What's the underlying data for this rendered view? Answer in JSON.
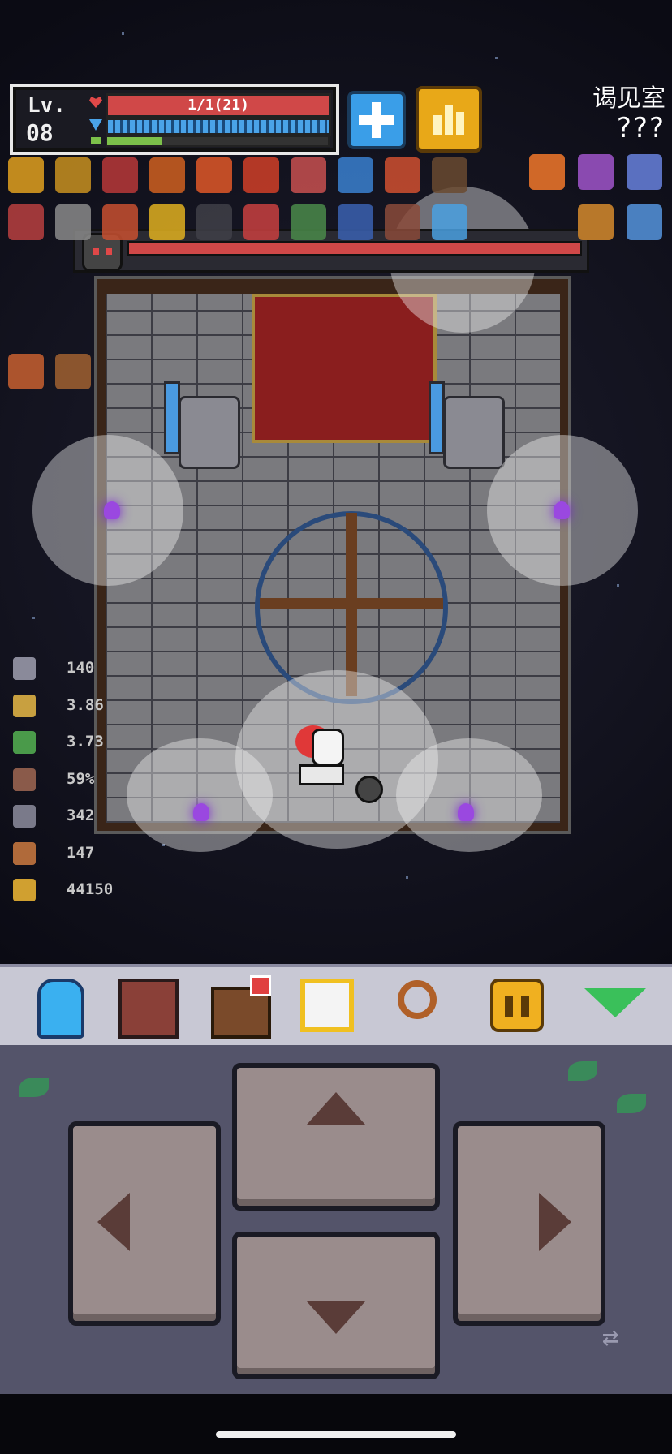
{
  "hud": {
    "level_label": "Lv.",
    "level_value": "08",
    "hp_text": "1/1(21)",
    "xp_fraction": 0.25,
    "mp_fraction": 1.0
  },
  "room": {
    "title": "谒见室",
    "subtitle": "???"
  },
  "boss": {
    "hp_fraction": 1.0
  },
  "stats": [
    {
      "icon": "sword-attack-icon",
      "value": "140",
      "color": "#8a8a9a"
    },
    {
      "icon": "crit-icon",
      "value": "3.86",
      "color": "#c8a040"
    },
    {
      "icon": "speed-boot-icon",
      "value": "3.73",
      "color": "#4a9a4a"
    },
    {
      "icon": "shield-icon",
      "value": "59%",
      "color": "#8a5a4a"
    },
    {
      "icon": "gray-key-icon",
      "value": "342",
      "color": "#7a7a8a"
    },
    {
      "icon": "bronze-key-icon",
      "value": "147",
      "color": "#b06a3a"
    },
    {
      "icon": "gold-coin-icon",
      "value": "44150",
      "color": "#d0a030"
    }
  ],
  "items": [
    {
      "icon": "golden-helm-icon",
      "color": "#e0a020"
    },
    {
      "icon": "golden-crest-icon",
      "color": "#c89020"
    },
    {
      "icon": "crimson-sword-icon",
      "color": "#b83838"
    },
    {
      "icon": "fire-wand-icon",
      "color": "#d06020"
    },
    {
      "icon": "fire-orb-icon",
      "color": "#e05828"
    },
    {
      "icon": "meteor-icon",
      "color": "#d04028"
    },
    {
      "icon": "potion-icon",
      "color": "#c85050"
    },
    {
      "icon": "blue-heart-icon",
      "color": "#3a80d0"
    },
    {
      "icon": "phoenix-icon",
      "color": "#d05030"
    },
    {
      "icon": "lantern-icon",
      "color": "#6a4a30"
    },
    {
      "icon": "cannon-icon",
      "color": "#b84040"
    },
    {
      "icon": "silver-axe-icon",
      "color": "#8a8a8a"
    },
    {
      "icon": "mushroom-icon",
      "color": "#c85030"
    },
    {
      "icon": "golden-pear-icon",
      "color": "#e0b020"
    },
    {
      "icon": "bomb-icon",
      "color": "#404048"
    },
    {
      "icon": "fang-icon",
      "color": "#c84040"
    },
    {
      "icon": "green-shield-icon",
      "color": "#4a8a4a"
    },
    {
      "icon": "compass-icon",
      "color": "#3a60b0"
    },
    {
      "icon": "club-icon",
      "color": "#8a4a3a"
    },
    {
      "icon": "ice-rune-icon",
      "color": "#4aa0e0"
    },
    {
      "icon": "flame-crown-icon",
      "color": "#c86030"
    },
    {
      "icon": "leather-bag-icon",
      "color": "#a06030"
    }
  ],
  "right_items": [
    {
      "icon": "fire-arrow-icon",
      "color": "#d06828"
    },
    {
      "icon": "purple-slingshot-icon",
      "color": "#8a4ab0"
    },
    {
      "icon": "rune-cube-icon",
      "color": "#5a70c0"
    },
    {
      "icon": "pizza-icon",
      "color": "#b8782a"
    },
    {
      "icon": "blue-skull-icon",
      "color": "#4a80c0"
    }
  ],
  "toolbar": [
    {
      "name": "character-button",
      "icon": "character-icon"
    },
    {
      "name": "book-button",
      "icon": "book-icon"
    },
    {
      "name": "bag-button",
      "icon": "bag-icon"
    },
    {
      "name": "focus-button",
      "icon": "focus-icon"
    },
    {
      "name": "search-button",
      "icon": "magnifier-icon"
    },
    {
      "name": "pause-button",
      "icon": "pause-icon"
    },
    {
      "name": "collapse-button",
      "icon": "triangle-down-icon"
    }
  ]
}
